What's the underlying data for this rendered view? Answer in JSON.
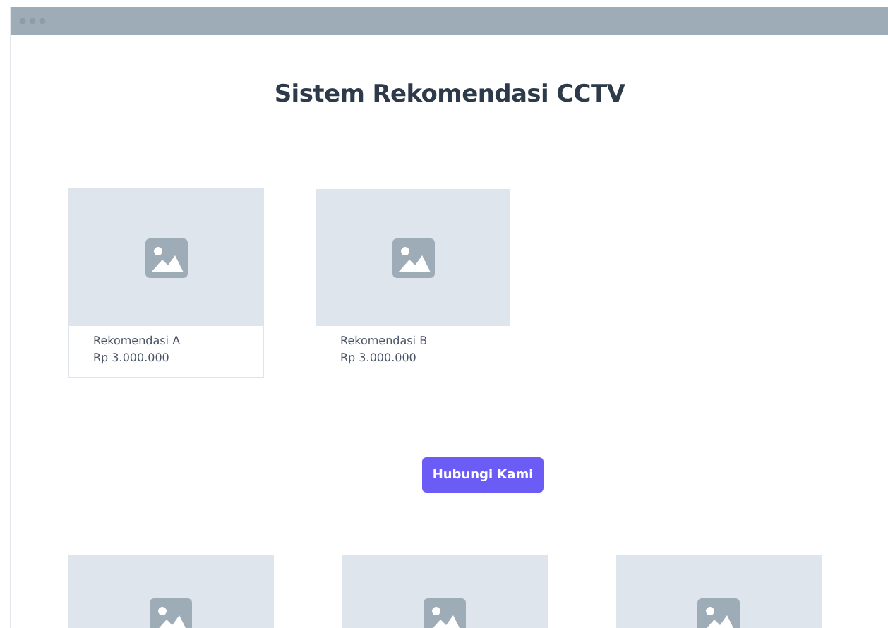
{
  "title": "Sistem  Rekomendasi CCTV",
  "recommendations": [
    {
      "name": "Rekomendasi A",
      "price": "Rp 3.000.000",
      "selected": true
    },
    {
      "name": "Rekomendasi B",
      "price": "Rp 3.000.000",
      "selected": false
    }
  ],
  "contact_button": "Hubungi Kami",
  "more_items": [
    {
      "kind": "placeholder"
    },
    {
      "kind": "placeholder"
    },
    {
      "kind": "placeholder"
    }
  ]
}
